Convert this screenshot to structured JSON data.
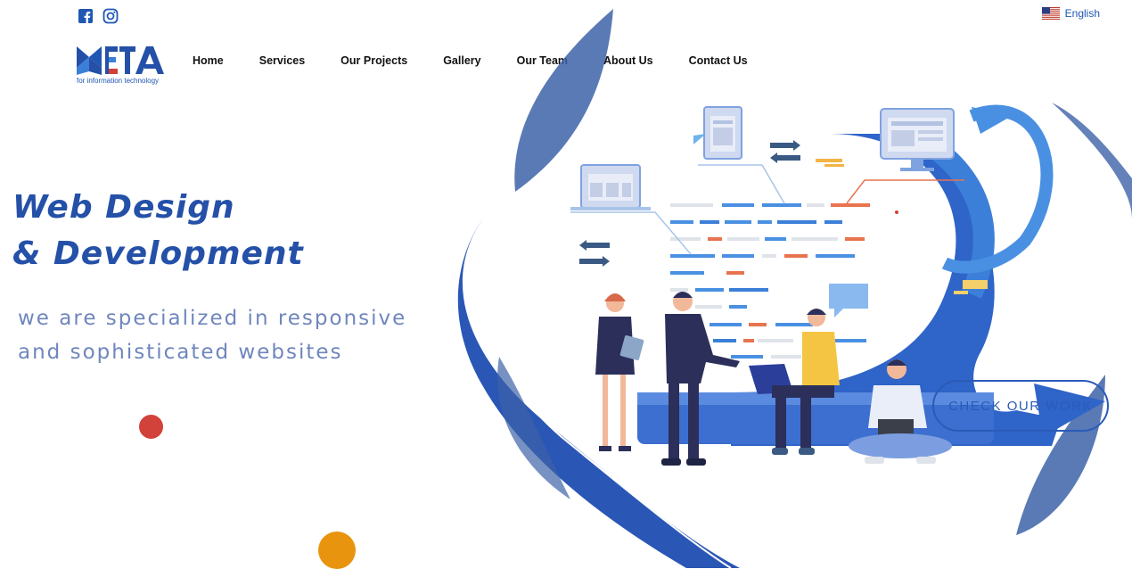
{
  "header": {
    "social": [
      "facebook-icon",
      "instagram-icon"
    ],
    "language": {
      "label": "English",
      "flag": "us-flag-icon"
    },
    "logo": {
      "text": "META",
      "subtitle": "for information technology"
    }
  },
  "nav": {
    "items": [
      {
        "label": "Home"
      },
      {
        "label": "Services"
      },
      {
        "label": "Our Projects"
      },
      {
        "label": "Gallery"
      },
      {
        "label": "Our Team"
      },
      {
        "label": "About Us"
      },
      {
        "label": "Contact Us"
      }
    ]
  },
  "hero": {
    "title_line1": "Web Design",
    "title_line2": "& Development",
    "subtitle_line1": "we are specialized in responsive",
    "subtitle_line2": "and sophisticated websites",
    "cta_label": "CHECK OUR WORK"
  },
  "colors": {
    "brand_blue": "#2450a8",
    "accent_red": "#d2413a",
    "accent_orange": "#e8940f"
  }
}
